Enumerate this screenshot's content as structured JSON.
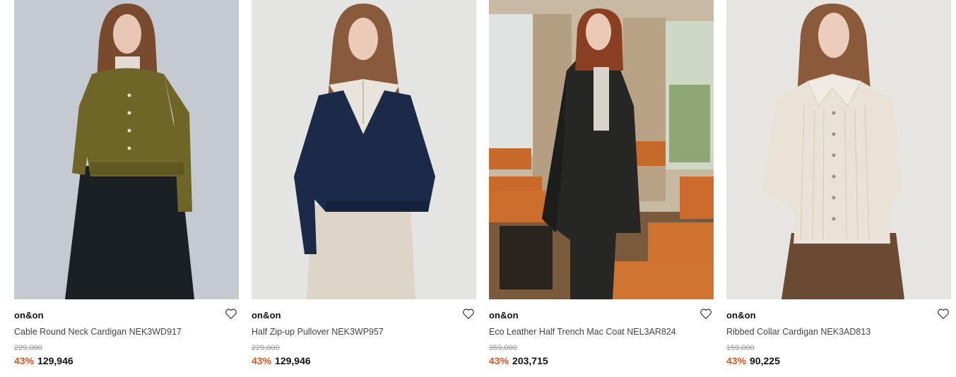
{
  "products": [
    {
      "brand": "on&on",
      "name": "Cable Round Neck Cardigan NEK3WD917",
      "original_price": "229,000",
      "discount": "43%",
      "price": "129,946",
      "image_alt": "model wearing olive cable knit cardigan and dark skirt"
    },
    {
      "brand": "on&on",
      "name": "Half Zip-up Pullover NEK3WP957",
      "original_price": "229,000",
      "discount": "43%",
      "price": "129,946",
      "image_alt": "model wearing navy half zip pullover and beige pants"
    },
    {
      "brand": "on&on",
      "name": "Eco Leather Half Trench Mac Coat NEL3AR824",
      "original_price": "359,000",
      "discount": "43%",
      "price": "203,715",
      "image_alt": "model wearing black leather trench coat in lecture hall"
    },
    {
      "brand": "on&on",
      "name": "Ribbed Collar Cardigan NEK3AD813",
      "original_price": "159,000",
      "discount": "43%",
      "price": "90,225",
      "image_alt": "model wearing ivory ribbed collar cardigan and brown pleated skirt"
    }
  ],
  "colors": {
    "discount": "#e8541e",
    "strike": "#999999"
  },
  "icons": {
    "wishlist": "heart-outline-icon"
  }
}
